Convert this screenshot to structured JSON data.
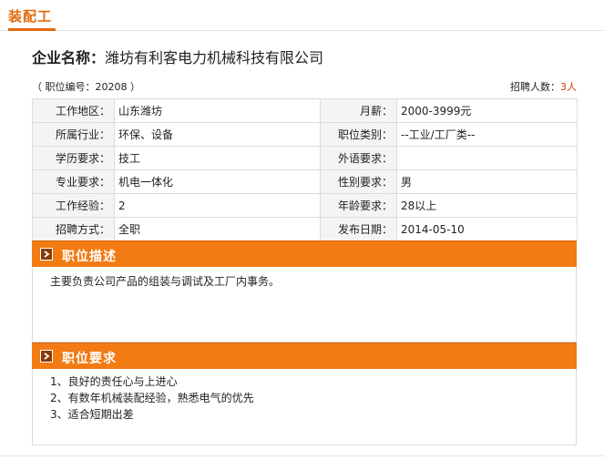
{
  "tab": {
    "title": "装配工"
  },
  "company": {
    "label": "企业名称：",
    "name": "潍坊有利客电力机械科技有限公司"
  },
  "meta": {
    "job_no": "（ 职位编号：20208 ）",
    "hire_label": "招聘人数：",
    "hire_count": "3人"
  },
  "info_rows": [
    {
      "l1": "工作地区：",
      "v1": "山东潍坊",
      "l2": "月薪：",
      "v2": "2000-3999元"
    },
    {
      "l1": "所属行业：",
      "v1": "环保、设备",
      "l2": "职位类别：",
      "v2": "--工业/工厂类--"
    },
    {
      "l1": "学历要求：",
      "v1": "技工",
      "l2": "外语要求：",
      "v2": ""
    },
    {
      "l1": "专业要求：",
      "v1": "机电一体化",
      "l2": "性别要求：",
      "v2": "男"
    },
    {
      "l1": "工作经验：",
      "v1": "2",
      "l2": "年龄要求：",
      "v2": "28以上"
    },
    {
      "l1": "招聘方式：",
      "v1": "全职",
      "l2": "发布日期：",
      "v2": "2014-05-10"
    }
  ],
  "description": {
    "title": "职位描述",
    "text": "主要负责公司产品的组装与调试及工厂内事务。"
  },
  "requirements": {
    "title": "职位要求",
    "items": [
      "1、良好的责任心与上进心",
      "2、有数年机械装配经验，熟悉电气的优先",
      "3、适合短期出差"
    ]
  },
  "colors": {
    "accent": "#f27b13",
    "tab_text": "#e46a0c",
    "count_text": "#d23a10"
  },
  "icons": {
    "section_marker": "chevron-right-icon"
  }
}
